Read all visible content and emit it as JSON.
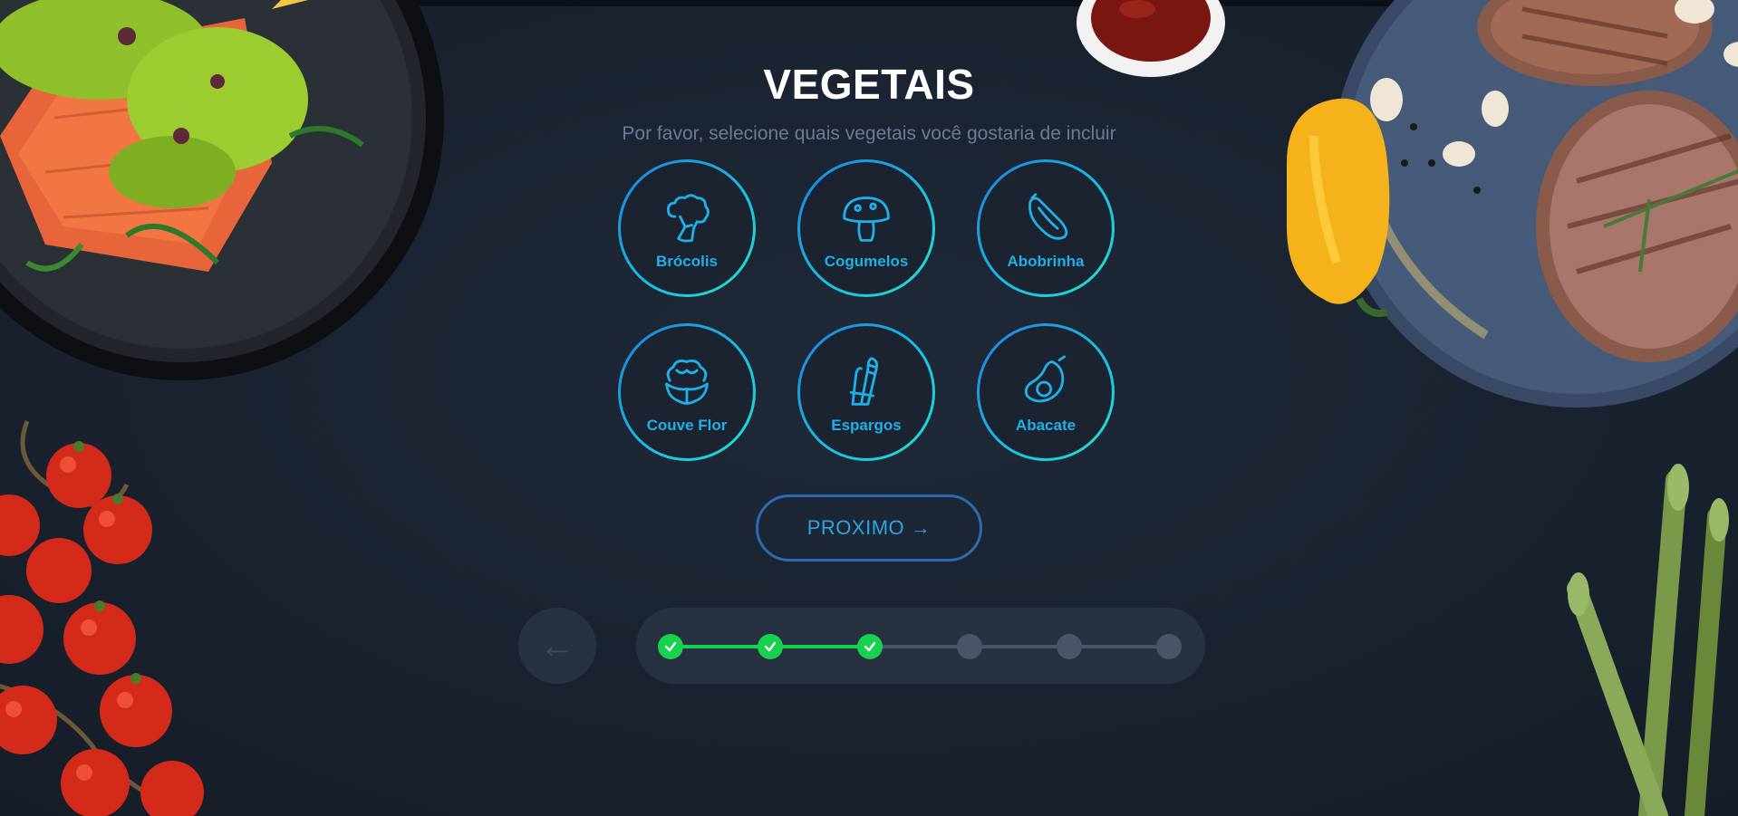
{
  "page": {
    "title": "VEGETAIS",
    "subtitle": "Por favor, selecione quais vegetais você gostaria de incluir"
  },
  "options": [
    {
      "label": "Brócolis",
      "icon": "broccoli-icon"
    },
    {
      "label": "Cogumelos",
      "icon": "mushroom-icon"
    },
    {
      "label": "Abobrinha",
      "icon": "zucchini-icon"
    },
    {
      "label": "Couve Flor",
      "icon": "cauliflower-icon"
    },
    {
      "label": "Espargos",
      "icon": "asparagus-icon"
    },
    {
      "label": "Abacate",
      "icon": "avocado-icon"
    }
  ],
  "next_button": {
    "label": "PROXIMO →"
  },
  "back_button": {
    "label": "←"
  },
  "progress": {
    "total_steps": 6,
    "completed_steps": 3,
    "completed_color": "#17d24f",
    "pending_color": "#4a5568"
  },
  "colors": {
    "background": "#1a2230",
    "accent_gradient_start": "#1d7fe0",
    "accent_gradient_end": "#24e0c8",
    "option_label": "#1eb0e8",
    "button_text": "#2ea3e3"
  }
}
